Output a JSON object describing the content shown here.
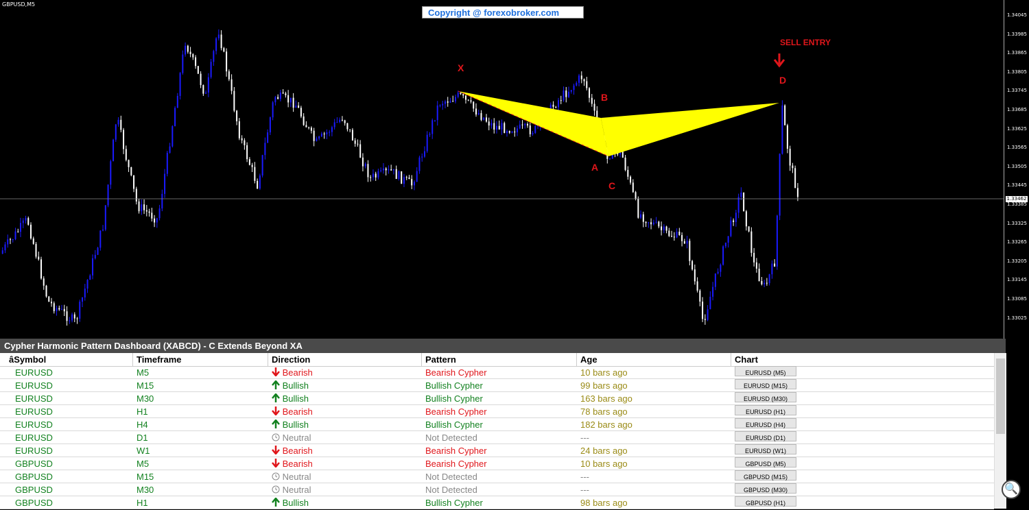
{
  "chart": {
    "symbol": "GBPUSD,M5",
    "copyright": "Copyright @ forexobroker.com",
    "current_price": "1.33462",
    "price_ticks": [
      "1.34045",
      "1.33985",
      "1.33865",
      "1.33805",
      "1.33745",
      "1.33685",
      "1.33625",
      "1.33565",
      "1.33505",
      "1.33445",
      "1.33385",
      "1.33325",
      "1.33265",
      "1.33205",
      "1.33145",
      "1.33085",
      "1.33025"
    ],
    "pattern_points": {
      "x": "X",
      "a": "A",
      "b": "B",
      "c": "C",
      "d": "D"
    },
    "sell_label": "SELL ENTRY",
    "colors": {
      "up": "#1a1aff",
      "down": "#ffffff",
      "pattern": "#ffff00",
      "marker": "#e0161b"
    }
  },
  "dashboard": {
    "title": "Cypher Harmonic Pattern Dashboard (XABCD) - C Extends Beyond XA",
    "columns": [
      "âSymbol",
      "Timeframe",
      "Direction",
      "Pattern",
      "Age",
      "Chart"
    ],
    "rows": [
      {
        "symbol": "EURUSD",
        "tf": "M5",
        "direction": "Bearish",
        "dir_icon": "arrow-down-icon",
        "pattern": "Bearish Cypher",
        "age": "10 bars ago",
        "chart": "EURUSD (M5)"
      },
      {
        "symbol": "EURUSD",
        "tf": "M15",
        "direction": "Bullish",
        "dir_icon": "arrow-up-icon",
        "pattern": "Bullish Cypher",
        "age": "99 bars ago",
        "chart": "EURUSD (M15)"
      },
      {
        "symbol": "EURUSD",
        "tf": "M30",
        "direction": "Bullish",
        "dir_icon": "arrow-up-icon",
        "pattern": "Bullish Cypher",
        "age": "163 bars ago",
        "chart": "EURUSD (M30)"
      },
      {
        "symbol": "EURUSD",
        "tf": "H1",
        "direction": "Bearish",
        "dir_icon": "arrow-down-icon",
        "pattern": "Bearish Cypher",
        "age": "78 bars ago",
        "chart": "EURUSD (H1)"
      },
      {
        "symbol": "EURUSD",
        "tf": "H4",
        "direction": "Bullish",
        "dir_icon": "arrow-up-icon",
        "pattern": "Bullish Cypher",
        "age": "182 bars ago",
        "chart": "EURUSD (H4)"
      },
      {
        "symbol": "EURUSD",
        "tf": "D1",
        "direction": "Neutral",
        "dir_icon": "clock-icon",
        "pattern": "Not Detected",
        "age": "---",
        "chart": "EURUSD (D1)"
      },
      {
        "symbol": "EURUSD",
        "tf": "W1",
        "direction": "Bearish",
        "dir_icon": "arrow-down-icon",
        "pattern": "Bearish Cypher",
        "age": "24 bars ago",
        "chart": "EURUSD (W1)"
      },
      {
        "symbol": "GBPUSD",
        "tf": "M5",
        "direction": "Bearish",
        "dir_icon": "arrow-down-icon",
        "pattern": "Bearish Cypher",
        "age": "10 bars ago",
        "chart": "GBPUSD (M5)"
      },
      {
        "symbol": "GBPUSD",
        "tf": "M15",
        "direction": "Neutral",
        "dir_icon": "clock-icon",
        "pattern": "Not Detected",
        "age": "---",
        "chart": "GBPUSD (M15)"
      },
      {
        "symbol": "GBPUSD",
        "tf": "M30",
        "direction": "Neutral",
        "dir_icon": "clock-icon",
        "pattern": "Not Detected",
        "age": "---",
        "chart": "GBPUSD (M30)"
      },
      {
        "symbol": "GBPUSD",
        "tf": "H1",
        "direction": "Bullish",
        "dir_icon": "arrow-up-icon",
        "pattern": "Bullish Cypher",
        "age": "98 bars ago",
        "chart": "GBPUSD (H1)"
      }
    ]
  }
}
